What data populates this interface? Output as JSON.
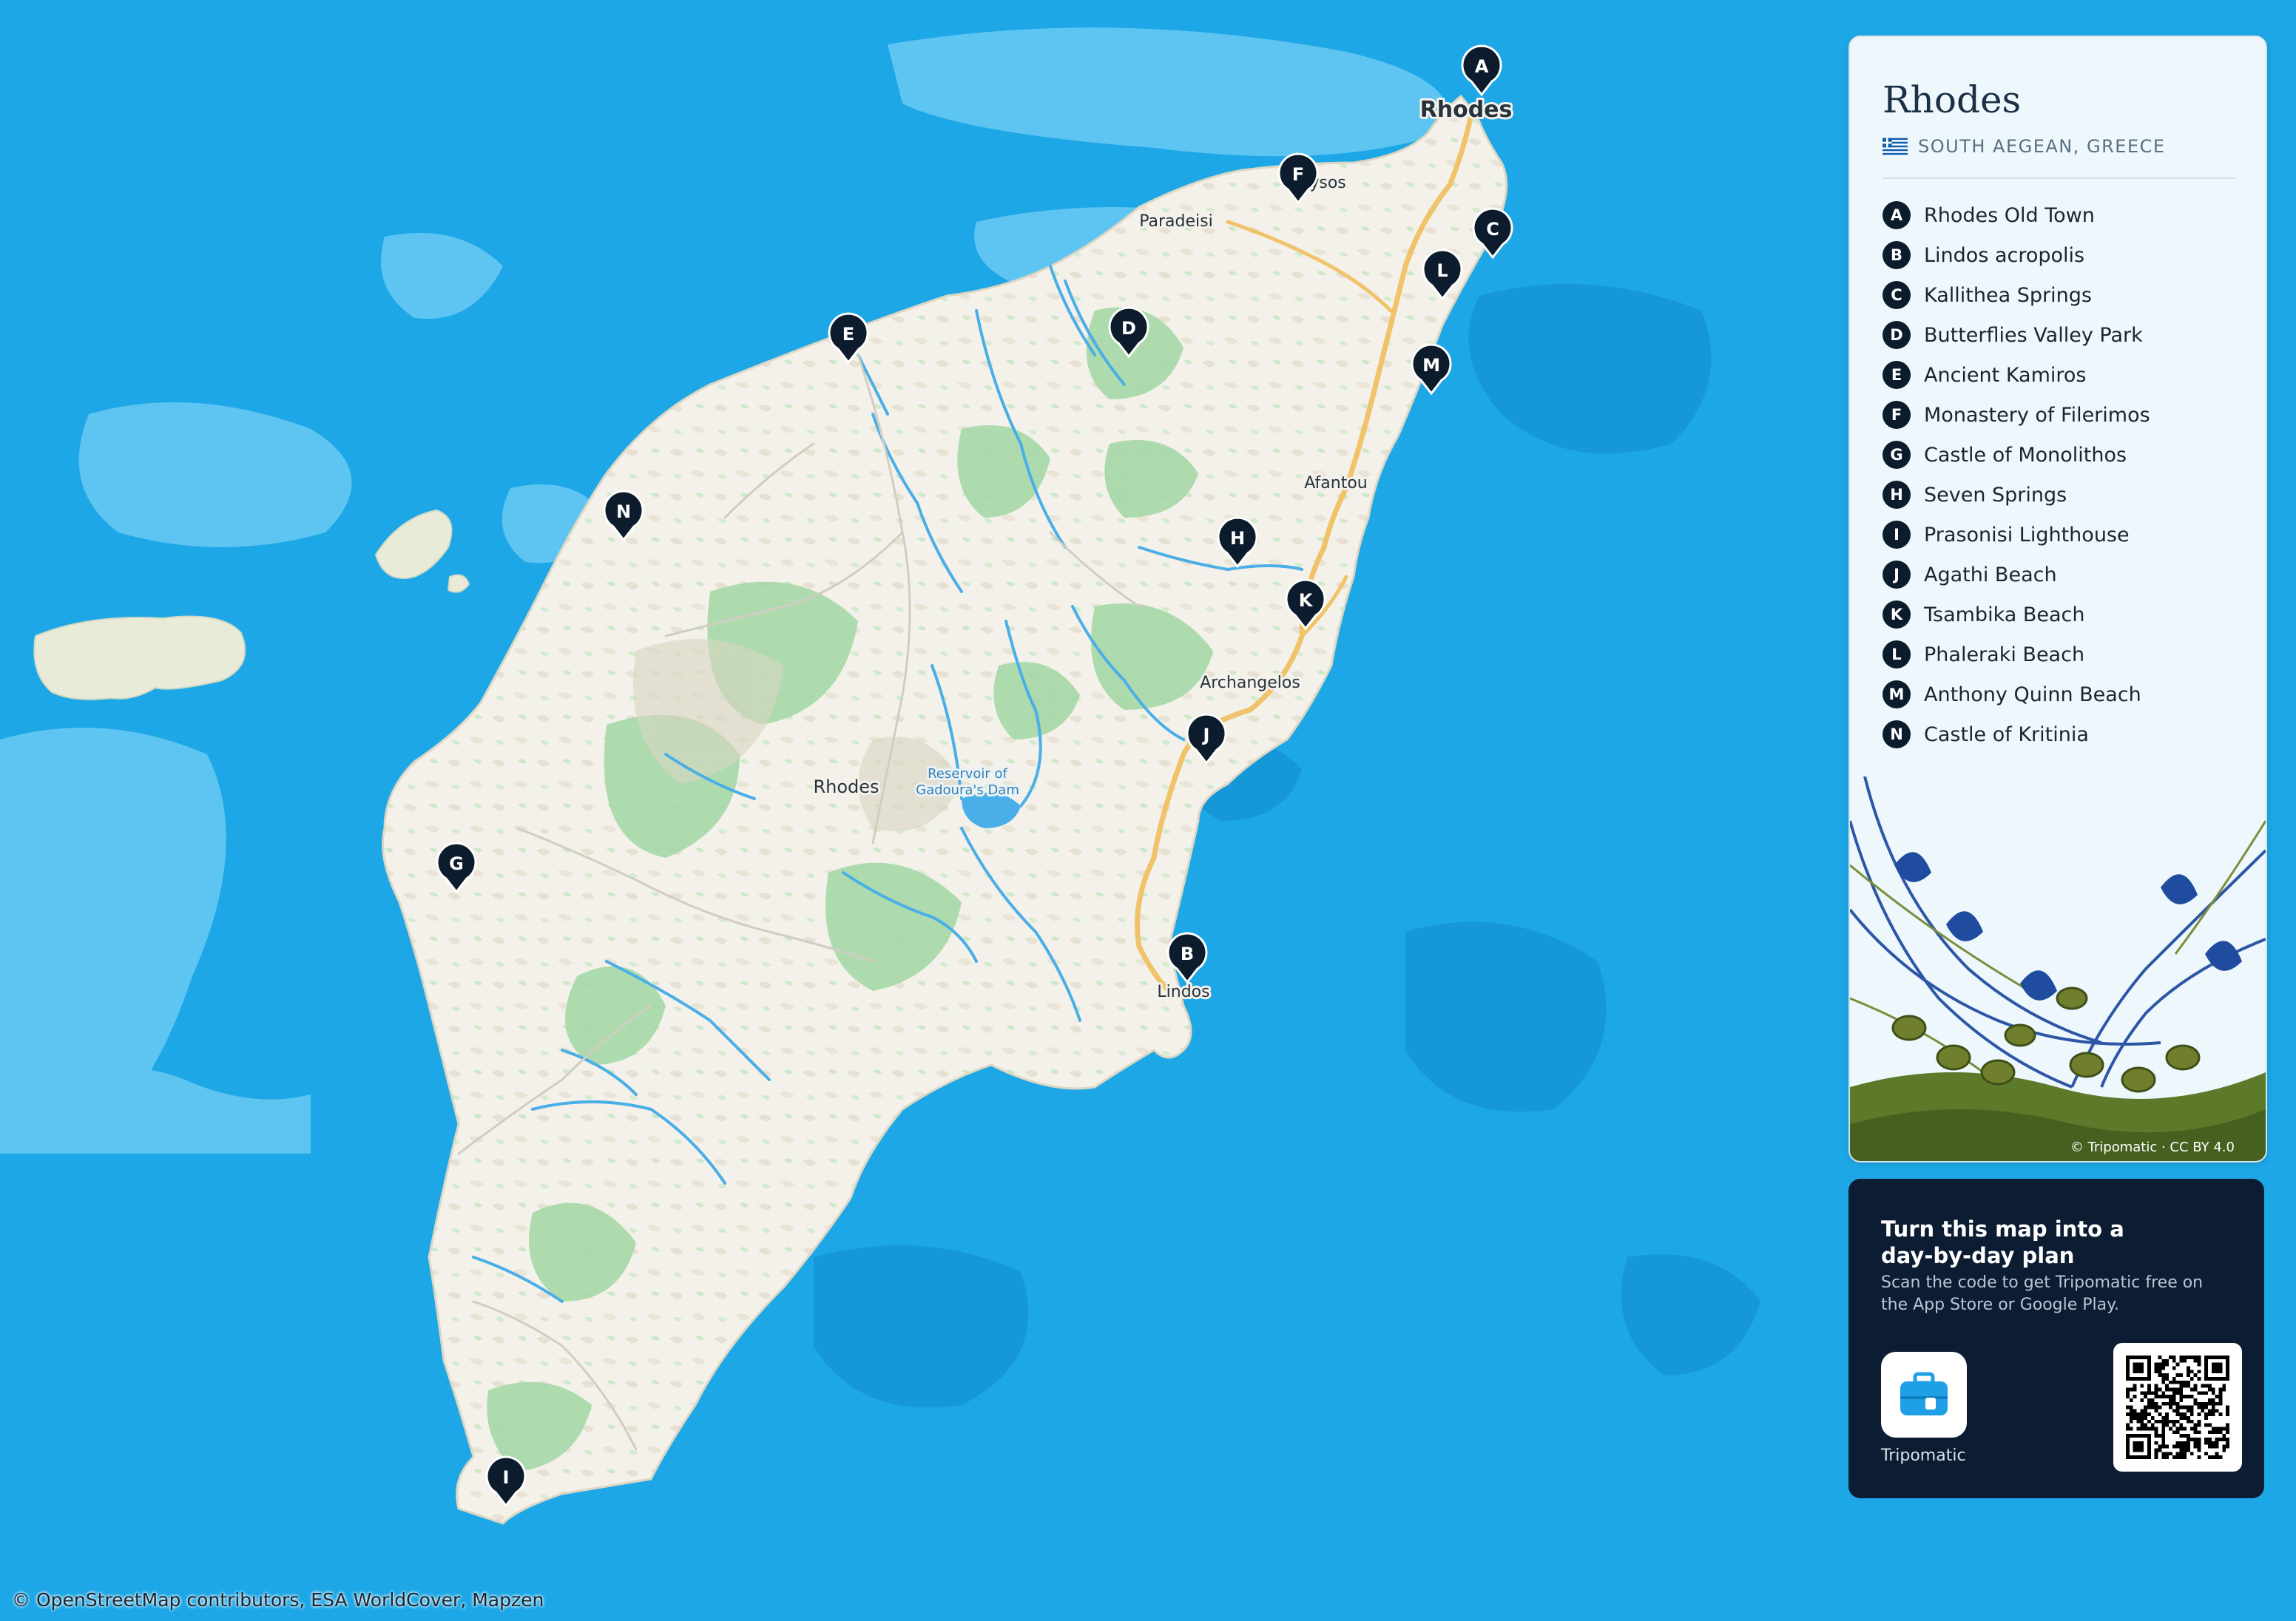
{
  "map": {
    "labels": {
      "city_rhodes": "Rhodes",
      "town_ialysos": "Ialysos",
      "town_paradeisi": "Paradeisi",
      "town_afantou": "Afantou",
      "town_archangelos": "Archangelos",
      "town_lindos": "Lindos",
      "island_rhodes": "Rhodes",
      "reservoir_line1": "Reservoir of",
      "reservoir_line2": "Gadoura's Dam"
    },
    "attribution": "© OpenStreetMap contributors, ESA WorldCover, Mapzen",
    "colors": {
      "sea": "#1da7e6",
      "shallow": "#5ec4f2",
      "deep": "#1596d6",
      "land": "#f3f1e9",
      "forest": "#8fd19a",
      "road": "#f0c36b",
      "river": "#4aaee8",
      "marker": "#0c1c2c"
    }
  },
  "markers": [
    {
      "letter": "A"
    },
    {
      "letter": "B"
    },
    {
      "letter": "C"
    },
    {
      "letter": "D"
    },
    {
      "letter": "E"
    },
    {
      "letter": "F"
    },
    {
      "letter": "G"
    },
    {
      "letter": "H"
    },
    {
      "letter": "I"
    },
    {
      "letter": "J"
    },
    {
      "letter": "K"
    },
    {
      "letter": "L"
    },
    {
      "letter": "M"
    },
    {
      "letter": "N"
    }
  ],
  "legend": {
    "title": "Rhodes",
    "subtitle": "SOUTH AEGEAN, GREECE",
    "flag_icon": "greece-flag-icon",
    "items": [
      {
        "letter": "A",
        "name": "Rhodes Old Town"
      },
      {
        "letter": "B",
        "name": "Lindos acropolis"
      },
      {
        "letter": "C",
        "name": "Kallithea Springs"
      },
      {
        "letter": "D",
        "name": "Butterflies Valley Park"
      },
      {
        "letter": "E",
        "name": "Ancient Kamiros"
      },
      {
        "letter": "F",
        "name": "Monastery of Filerimos"
      },
      {
        "letter": "G",
        "name": "Castle of Monolithos"
      },
      {
        "letter": "H",
        "name": "Seven Springs"
      },
      {
        "letter": "I",
        "name": "Prasonisi Lighthouse"
      },
      {
        "letter": "J",
        "name": "Agathi Beach"
      },
      {
        "letter": "K",
        "name": "Tsambika Beach"
      },
      {
        "letter": "L",
        "name": "Phaleraki Beach"
      },
      {
        "letter": "M",
        "name": "Anthony Quinn Beach"
      },
      {
        "letter": "N",
        "name": "Castle of Kritinia"
      }
    ],
    "art_credit": "© Tripomatic · CC BY 4.0"
  },
  "promo": {
    "heading": "Turn this map into a day-by-day plan",
    "text": "Scan the code to get Tripomatic free on the App Store or Google Play.",
    "app_name": "Tripomatic",
    "app_icon": "suitcase-icon",
    "qr_icon": "qr-code-icon"
  }
}
